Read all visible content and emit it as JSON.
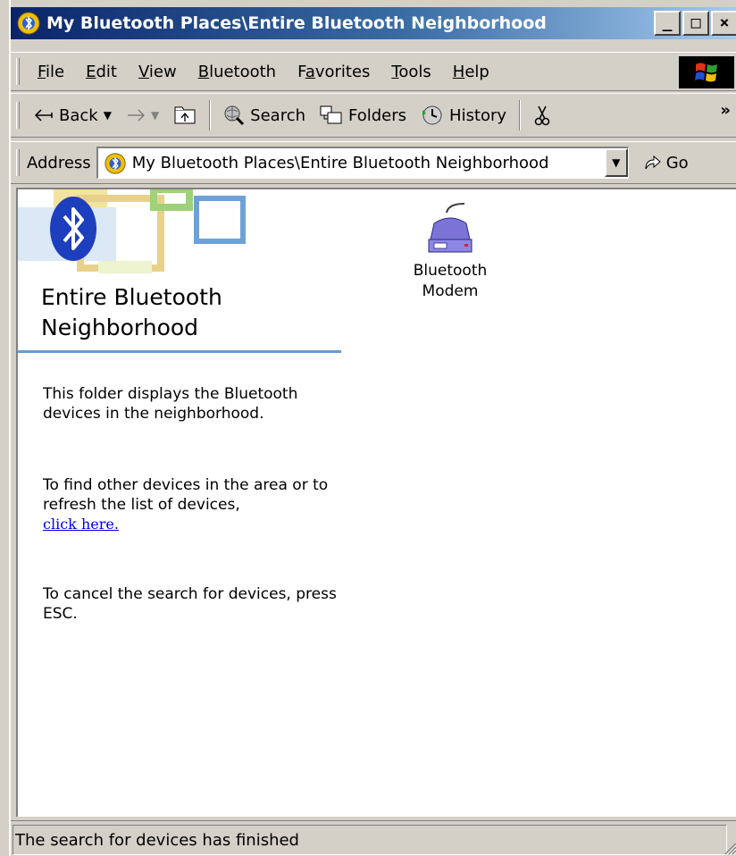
{
  "window": {
    "title": "My Bluetooth Places\\Entire Bluetooth Neighborhood"
  },
  "caption_buttons": {
    "minimize": "_",
    "maximize": "□",
    "close": "×"
  },
  "menubar": {
    "items": [
      {
        "label": "File",
        "mnemonic": "F"
      },
      {
        "label": "Edit",
        "mnemonic": "E"
      },
      {
        "label": "View",
        "mnemonic": "V"
      },
      {
        "label": "Bluetooth",
        "mnemonic": "B"
      },
      {
        "label": "Favorites",
        "mnemonic": "a"
      },
      {
        "label": "Tools",
        "mnemonic": "T"
      },
      {
        "label": "Help",
        "mnemonic": "H"
      }
    ]
  },
  "toolbar": {
    "back_label": "Back",
    "search_label": "Search",
    "folders_label": "Folders",
    "history_label": "History",
    "more": "»"
  },
  "addressbar": {
    "label": "Address",
    "value": "My Bluetooth Places\\Entire Bluetooth Neighborhood",
    "go_label": "Go"
  },
  "infopane": {
    "title": "Entire Bluetooth Neighborhood",
    "para1": "This folder displays the Bluetooth devices in the neighborhood.",
    "para2": "To find other devices in the area or to refresh the list of devices,",
    "link": "click here.",
    "para3": "To cancel the search for devices, press ESC."
  },
  "devices": [
    {
      "label": "Bluetooth Modem",
      "icon": "modem-icon"
    }
  ],
  "statusbar": {
    "text": "The search for devices has finished"
  },
  "colors": {
    "title_gradient_start": "#0a246a",
    "title_gradient_end": "#a6caf0",
    "face": "#d4d0c8",
    "link": "#0000ee",
    "rule": "#6a9ad0",
    "bluetooth_blue": "#1d3fbd"
  }
}
